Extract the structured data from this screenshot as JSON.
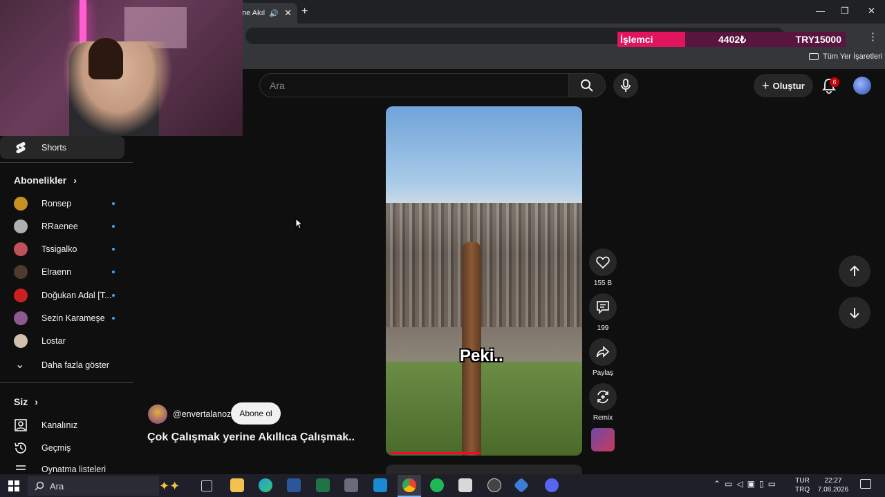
{
  "browser": {
    "tab_title": "ne Akıl",
    "bookmarks_all": "Tüm Yer İşaretleri",
    "ticker": {
      "label": "İşlemci",
      "value": "4402₺",
      "currency": "TRY15000"
    }
  },
  "header": {
    "search_placeholder": "Ara",
    "create_label": "Oluştur",
    "notification_count": "6"
  },
  "sidebar": {
    "shorts_label": "Shorts",
    "subscriptions_title": "Abonelikler",
    "subscriptions": [
      {
        "name": "Ronsep",
        "color": "#c89020",
        "new": true
      },
      {
        "name": "RRaenee",
        "color": "#b0b0b0",
        "new": true
      },
      {
        "name": "Tssigalko",
        "color": "#c0505a",
        "new": true
      },
      {
        "name": "Elraenn",
        "color": "#503a30",
        "new": true
      },
      {
        "name": "Doğukan Adal [T...",
        "color": "#cc2020",
        "new": true
      },
      {
        "name": "Sezin Karameşe",
        "color": "#8a5a90",
        "new": true
      },
      {
        "name": "Lostar",
        "color": "#d0c0b0",
        "new": false
      }
    ],
    "show_more": "Daha fazla göster",
    "you_title": "Siz",
    "you_items": [
      "Kanalınız",
      "Geçmiş",
      "Oynatma listeleri"
    ]
  },
  "video": {
    "caption": "Peki..",
    "channel": "@envertalanoz",
    "subscribe": "Abone ol",
    "title": "Çok Çalışmak yerine Akıllıca Çalışmak..",
    "likes": "155 B",
    "comments": "199",
    "share": "Paylaş",
    "remix": "Remix",
    "progress": 0.48
  },
  "taskbar": {
    "search": "Ara",
    "lang_top": "TUR",
    "lang_bottom": "TRQ",
    "time": "22:27",
    "date": "7.08.2026"
  }
}
